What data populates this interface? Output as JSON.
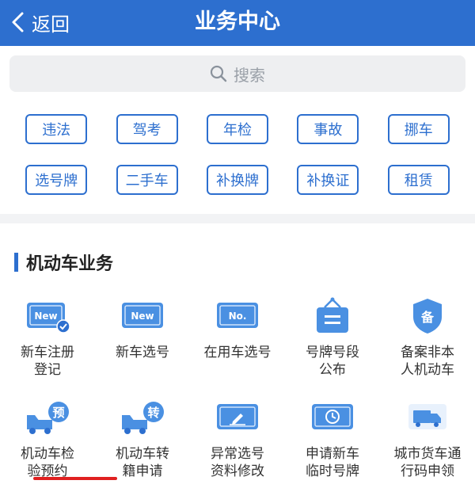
{
  "header": {
    "back_label": "返回",
    "title": "业务中心"
  },
  "search": {
    "placeholder": "搜索"
  },
  "tags": {
    "row1": [
      "违法",
      "驾考",
      "年检",
      "事故",
      "挪车"
    ],
    "row2": [
      "选号牌",
      "二手车",
      "补换牌",
      "补换证",
      "租赁"
    ]
  },
  "section": {
    "title": "机动车业务",
    "services": [
      {
        "line1": "新车注册",
        "line2": "登记",
        "icon": "new-plate-check-icon"
      },
      {
        "line1": "新车选号",
        "line2": "",
        "icon": "new-plate-icon"
      },
      {
        "line1": "在用车选号",
        "line2": "",
        "icon": "no-plate-icon"
      },
      {
        "line1": "号牌号段",
        "line2": "公布",
        "icon": "hanging-sign-icon"
      },
      {
        "line1": "备案非本",
        "line2": "人机动车",
        "icon": "shield-record-icon"
      },
      {
        "line1": "机动车检",
        "line2": "验预约",
        "icon": "truck-reserve-icon"
      },
      {
        "line1": "机动车转",
        "line2": "籍申请",
        "icon": "truck-transfer-icon"
      },
      {
        "line1": "异常选号",
        "line2": "资料修改",
        "icon": "plate-edit-icon"
      },
      {
        "line1": "申请新车",
        "line2": "临时号牌",
        "icon": "plate-clock-icon"
      },
      {
        "line1": "城市货车通",
        "line2": "行码申领",
        "icon": "cargo-truck-icon"
      }
    ]
  },
  "colors": {
    "primary": "#2d6fcf",
    "icon_light": "#4a90e2",
    "underline": "#e02020"
  }
}
